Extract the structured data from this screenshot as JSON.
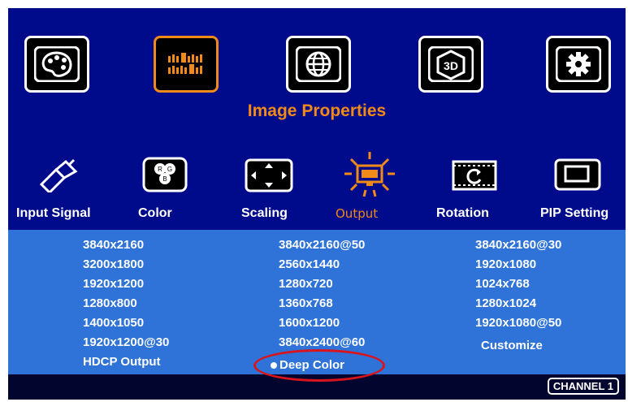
{
  "menu": {
    "title": "Image Properties",
    "top_icons": [
      "palette-icon",
      "image-properties-icon",
      "globe-icon",
      "3d-icon",
      "settings-gear-icon"
    ],
    "submenu": [
      {
        "label": "Input Signal"
      },
      {
        "label": "Color"
      },
      {
        "label": "Scaling"
      },
      {
        "label": "Output"
      },
      {
        "label": "Rotation"
      },
      {
        "label": "PIP Setting"
      }
    ]
  },
  "output_options": {
    "col1": [
      "3840x2160",
      "3200x1800",
      "1920x1200",
      "1280x800",
      "1400x1050",
      "1920x1200@30",
      "HDCP Output"
    ],
    "col2": [
      "3840x2160@50",
      "2560x1440",
      "1280x720",
      "1360x768",
      "1600x1200",
      "3840x2400@60",
      "Deep Color"
    ],
    "col3": [
      "3840x2160@30",
      "1920x1080",
      "1024x768",
      "1280x1024",
      "1920x1080@50",
      "Customize"
    ]
  },
  "status": {
    "channel": "CHANNEL 1"
  },
  "colors": {
    "background": "#000b8c",
    "panel": "#2f73d8",
    "accent": "#f08a18",
    "highlight": "#d8141c"
  }
}
